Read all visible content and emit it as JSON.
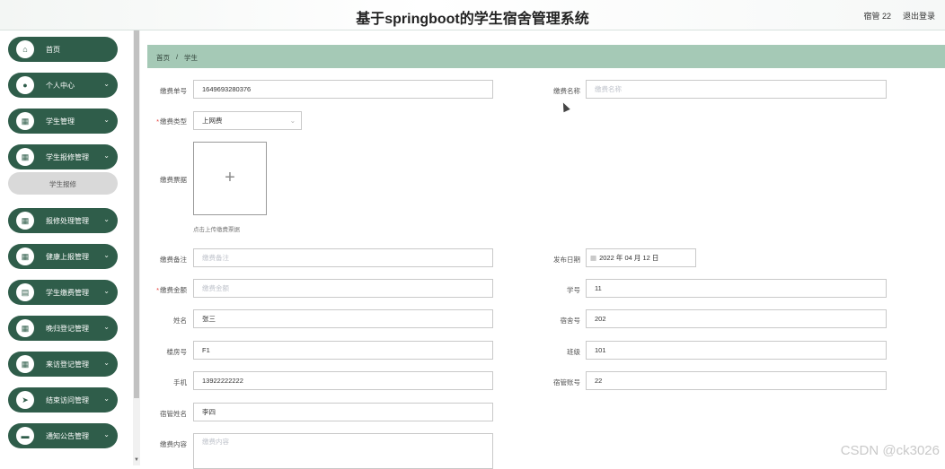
{
  "header": {
    "title": "基于springboot的学生宿舍管理系统",
    "user": "宿管 22",
    "logout": "退出登录"
  },
  "sidebar": {
    "items": [
      {
        "label": "首页",
        "icon": "home-icon",
        "glyph": "⌂",
        "chevron": ""
      },
      {
        "label": "个人中心",
        "icon": "user-icon",
        "glyph": "●",
        "chevron": "⌄"
      },
      {
        "label": "学生管理",
        "icon": "grid-icon",
        "glyph": "▦",
        "chevron": "⌄"
      },
      {
        "label": "学生报修管理",
        "icon": "grid-icon",
        "glyph": "▦",
        "chevron": "⌄"
      },
      {
        "label": "报修处理管理",
        "icon": "grid-icon",
        "glyph": "▦",
        "chevron": "⌄"
      },
      {
        "label": "健康上报管理",
        "icon": "grid-icon",
        "glyph": "▦",
        "chevron": "⌄"
      },
      {
        "label": "学生缴费管理",
        "icon": "clipboard-icon",
        "glyph": "▤",
        "chevron": "⌄"
      },
      {
        "label": "晚归登记管理",
        "icon": "grid-icon",
        "glyph": "▦",
        "chevron": "⌄"
      },
      {
        "label": "来访登记管理",
        "icon": "calendar-icon",
        "glyph": "▦",
        "chevron": "⌄"
      },
      {
        "label": "结束访问管理",
        "icon": "send-icon",
        "glyph": "➤",
        "chevron": "⌄"
      },
      {
        "label": "通知公告管理",
        "icon": "monitor-icon",
        "glyph": "▬",
        "chevron": "⌄"
      }
    ],
    "sub_item": "学生报修"
  },
  "breadcrumb": {
    "home": "首页",
    "sep": "/",
    "current": "学生"
  },
  "form": {
    "billing_no": {
      "label": "缴费单号",
      "value": "1649693280376"
    },
    "billing_name": {
      "label": "缴费名称",
      "placeholder": "缴费名称"
    },
    "billing_type": {
      "label": "缴费类型",
      "value": "上网费"
    },
    "billing_image": {
      "label": "缴费票据",
      "hint": "点击上传缴费票据"
    },
    "billing_note": {
      "label": "缴费备注",
      "placeholder": "缴费备注"
    },
    "publish_date": {
      "label": "发布日期",
      "value": "2022 年 04 月 12 日"
    },
    "amount": {
      "label": "缴费金额",
      "placeholder": "缴费金额"
    },
    "student_no": {
      "label": "学号",
      "value": "11"
    },
    "name": {
      "label": "姓名",
      "value": "张三"
    },
    "dorm_no": {
      "label": "宿舍号",
      "value": "202"
    },
    "building_no": {
      "label": "楼房号",
      "value": "F1"
    },
    "class": {
      "label": "班级",
      "value": "101"
    },
    "phone": {
      "label": "手机",
      "value": "13922222222"
    },
    "manager_account": {
      "label": "宿管账号",
      "value": "22"
    },
    "manager_name": {
      "label": "宿管姓名",
      "value": "李四"
    },
    "content": {
      "label": "缴费内容",
      "placeholder": "缴费内容"
    }
  },
  "watermark": "CSDN @ck3026"
}
